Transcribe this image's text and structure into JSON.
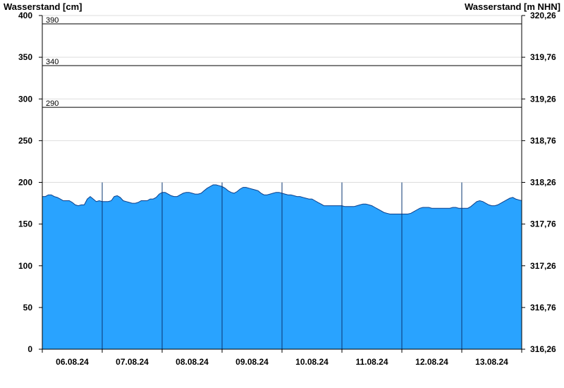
{
  "chart_data": {
    "type": "area",
    "ylabel_left": "Wasserstand [cm]",
    "ylabel_right": "Wasserstand [m NHN]",
    "ylim": [
      0,
      400
    ],
    "y_ticks": [
      0,
      50,
      100,
      150,
      200,
      250,
      300,
      350,
      400
    ],
    "right_ticks": [
      "316,26",
      "316,76",
      "317,26",
      "317,76",
      "318,26",
      "318,76",
      "319,26",
      "319,76",
      "320,26"
    ],
    "x_labels": [
      "06.08.24",
      "07.08.24",
      "08.08.24",
      "09.08.24",
      "10.08.24",
      "11.08.24",
      "12.08.24",
      "13.08.24"
    ],
    "reference_lines": [
      {
        "value": 390,
        "label": "390"
      },
      {
        "value": 340,
        "label": "340"
      },
      {
        "value": 290,
        "label": "290"
      }
    ],
    "grid": true,
    "fill_color": "#29a3ff",
    "series": [
      {
        "x": [
          0,
          0.05,
          0.1,
          0.15,
          0.2,
          0.25,
          0.3,
          0.35,
          0.4,
          0.45,
          0.5,
          0.55,
          0.6,
          0.65,
          0.7,
          0.75,
          0.8,
          0.85,
          0.9,
          0.95,
          1.0,
          1.05,
          1.1,
          1.15,
          1.2,
          1.25,
          1.3,
          1.35,
          1.4,
          1.45,
          1.5,
          1.55,
          1.6,
          1.65,
          1.7,
          1.75,
          1.8,
          1.85,
          1.9,
          1.95,
          2.0,
          2.05,
          2.1,
          2.15,
          2.2,
          2.25,
          2.3,
          2.35,
          2.4,
          2.45,
          2.5,
          2.55,
          2.6,
          2.65,
          2.7,
          2.75,
          2.8,
          2.85,
          2.9,
          2.95,
          3.0,
          3.05,
          3.1,
          3.15,
          3.2,
          3.25,
          3.3,
          3.35,
          3.4,
          3.45,
          3.5,
          3.55,
          3.6,
          3.65,
          3.7,
          3.75,
          3.8,
          3.85,
          3.9,
          3.95,
          4.0,
          4.05,
          4.1,
          4.15,
          4.2,
          4.25,
          4.3,
          4.35,
          4.4,
          4.45,
          4.5,
          4.55,
          4.6,
          4.65,
          4.7,
          4.75,
          4.8,
          4.85,
          4.9,
          4.95,
          5.0,
          5.05,
          5.1,
          5.15,
          5.2,
          5.25,
          5.3,
          5.35,
          5.4,
          5.45,
          5.5,
          5.55,
          5.6,
          5.65,
          5.7,
          5.75,
          5.8,
          5.85,
          5.9,
          5.95,
          6.0,
          6.05,
          6.1,
          6.15,
          6.2,
          6.25,
          6.3,
          6.35,
          6.4,
          6.45,
          6.5,
          6.55,
          6.6,
          6.65,
          6.7,
          6.75,
          6.8,
          6.85,
          6.9,
          6.95,
          7.0,
          7.05,
          7.1,
          7.15,
          7.2,
          7.25,
          7.3,
          7.35,
          7.4,
          7.45,
          7.5,
          7.55,
          7.6,
          7.65,
          7.7,
          7.75,
          7.8,
          7.85,
          7.9,
          7.95,
          8.0
        ],
        "values": [
          183,
          183,
          185,
          185,
          183,
          182,
          180,
          178,
          178,
          178,
          176,
          173,
          172,
          173,
          173,
          180,
          183,
          180,
          177,
          178,
          177,
          177,
          177,
          178,
          183,
          184,
          182,
          178,
          177,
          176,
          175,
          175,
          176,
          178,
          178,
          178,
          180,
          180,
          182,
          186,
          188,
          188,
          186,
          184,
          183,
          183,
          185,
          187,
          188,
          188,
          187,
          186,
          186,
          187,
          190,
          193,
          195,
          197,
          197,
          196,
          195,
          193,
          190,
          188,
          187,
          189,
          192,
          194,
          194,
          193,
          192,
          191,
          190,
          187,
          185,
          185,
          186,
          187,
          188,
          188,
          187,
          186,
          185,
          185,
          184,
          183,
          183,
          182,
          181,
          180,
          180,
          178,
          176,
          174,
          172,
          172,
          172,
          172,
          172,
          172,
          172,
          171,
          171,
          171,
          171,
          172,
          173,
          174,
          174,
          173,
          172,
          170,
          168,
          166,
          164,
          163,
          162,
          162,
          162,
          162,
          162,
          162,
          162,
          163,
          165,
          167,
          169,
          170,
          170,
          170,
          169,
          169,
          169,
          169,
          169,
          169,
          169,
          170,
          170,
          169,
          169,
          169,
          169,
          171,
          174,
          177,
          178,
          177,
          175,
          173,
          172,
          172,
          173,
          175,
          177,
          179,
          181,
          182,
          180,
          179,
          178
        ]
      }
    ]
  }
}
